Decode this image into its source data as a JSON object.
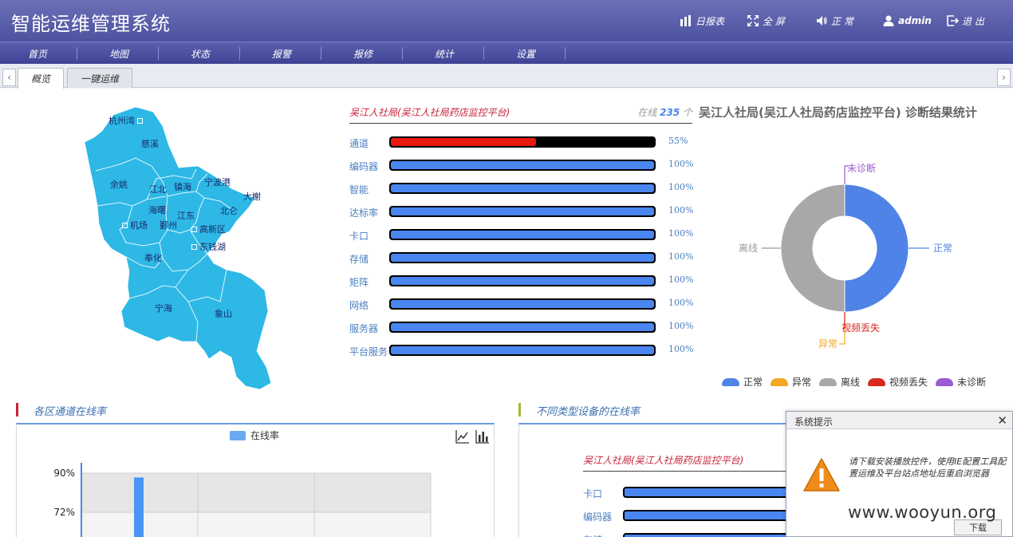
{
  "app": {
    "title": "智能运维管理系统"
  },
  "header": {
    "daily_report": "日报表",
    "fullscreen": "全 屏",
    "sound": "正 常",
    "user": "admin",
    "logout": "退 出"
  },
  "nav": [
    "首页",
    "地图",
    "状态",
    "报警",
    "报修",
    "统计",
    "设置"
  ],
  "tabs": [
    "概览",
    "一键运维"
  ],
  "map": {
    "regions": [
      "杭州湾",
      "慈溪",
      "余姚",
      "江北",
      "镇海",
      "宁波港",
      "大榭",
      "北仑",
      "海曙",
      "江东",
      "机场",
      "鄞州",
      "高新区",
      "东钱湖",
      "奉化",
      "宁海",
      "象山"
    ]
  },
  "status": {
    "title": "吴江人社局(吴江人社局药店监控平台)",
    "online_label": "在线",
    "online_count": "235",
    "online_unit": "个",
    "items": [
      {
        "label": "通道",
        "pct_text": "55%",
        "pct": 55,
        "color": "#e8190c"
      },
      {
        "label": "编码器",
        "pct_text": "100%",
        "pct": 100,
        "color": "#4a86f0"
      },
      {
        "label": "智能",
        "pct_text": "100%",
        "pct": 100,
        "color": "#4a86f0"
      },
      {
        "label": "达标率",
        "pct_text": "100%",
        "pct": 100,
        "color": "#4a86f0"
      },
      {
        "label": "卡口",
        "pct_text": "100%",
        "pct": 100,
        "color": "#4a86f0"
      },
      {
        "label": "存储",
        "pct_text": "100%",
        "pct": 100,
        "color": "#4a86f0"
      },
      {
        "label": "矩阵",
        "pct_text": "100%",
        "pct": 100,
        "color": "#4a86f0"
      },
      {
        "label": "网络",
        "pct_text": "100%",
        "pct": 100,
        "color": "#4a86f0"
      },
      {
        "label": "服务器",
        "pct_text": "100%",
        "pct": 100,
        "color": "#4a86f0"
      },
      {
        "label": "平台服务",
        "pct_text": "100%",
        "pct": 100,
        "color": "#4a86f0"
      }
    ]
  },
  "donut": {
    "title": "吴江人社局(吴江人社局药店监控平台) 诊断结果统计",
    "slices": [
      {
        "name": "正常",
        "value": 50,
        "color": "#4f83e8"
      },
      {
        "name": "异常",
        "value": 0,
        "color": "#f5a623"
      },
      {
        "name": "离线",
        "value": 50,
        "color": "#a8a8a8"
      },
      {
        "name": "视频丢失",
        "value": 0,
        "color": "#d8291e"
      },
      {
        "name": "未诊断",
        "value": 0,
        "color": "#9b5bd1"
      }
    ]
  },
  "section_left": {
    "title": "各区通道在线率",
    "bar_color": "#c7243a"
  },
  "section_right": {
    "title": "不同类型设备的在线率",
    "bar_color": "#9bbf30"
  },
  "chart_data": {
    "type": "bar",
    "title": "",
    "series": [
      {
        "name": "在线率",
        "values": [
          88
        ]
      }
    ],
    "categories": [
      ""
    ],
    "yticks": [
      "90%",
      "72%"
    ],
    "ylim": [
      0,
      100
    ],
    "grid": true,
    "legend": "top-center"
  },
  "right_panel": {
    "title": "吴江人社局(吴江人社局药店监控平台)",
    "items": [
      "卡口",
      "编码器",
      "存储"
    ]
  },
  "dialog": {
    "title": "系统提示",
    "message": "请下载安装播放控件，使用IE配置工具配置运维及平台站点地址后重启浏览器",
    "button": "下载"
  },
  "watermark": "www.wooyun.org"
}
